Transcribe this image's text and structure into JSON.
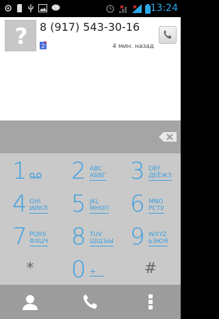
{
  "status_bar": {
    "time": "13:24",
    "icons": [
      "location-icon",
      "sd-card-icon",
      "usb-icon",
      "image-icon",
      "chat-icon",
      "alarm-icon",
      "signal-icon",
      "signal-icon",
      "battery-icon"
    ]
  },
  "call_log": {
    "entries": [
      {
        "number": "8 (917) 543-30-16",
        "avatar_glyph": "?",
        "time_ago": "4 мин. назад",
        "sim_badge": "2"
      }
    ]
  },
  "keypad": {
    "keys": [
      {
        "digit": "1",
        "line1": "",
        "line2": ""
      },
      {
        "digit": "2",
        "line1": "ABC",
        "line2": "АБВГ"
      },
      {
        "digit": "3",
        "line1": "DEF",
        "line2": "ДЕЁЖЗ"
      },
      {
        "digit": "4",
        "line1": "GHI",
        "line2": "ИЙКЛ"
      },
      {
        "digit": "5",
        "line1": "JKL",
        "line2": "МНОП"
      },
      {
        "digit": "6",
        "line1": "MNO",
        "line2": "РСТУ"
      },
      {
        "digit": "7",
        "line1": "PQRS",
        "line2": "ФХЦЧ"
      },
      {
        "digit": "8",
        "line1": "TUV",
        "line2": "ШЩЪЫ"
      },
      {
        "digit": "9",
        "line1": "WXYZ",
        "line2": "ЬЭЮЯ"
      },
      {
        "digit": "*"
      },
      {
        "digit": "0",
        "line2": "+"
      },
      {
        "digit": "#"
      }
    ]
  },
  "colors": {
    "accent": "#3d9fe0",
    "time": "#2aa8e8"
  }
}
